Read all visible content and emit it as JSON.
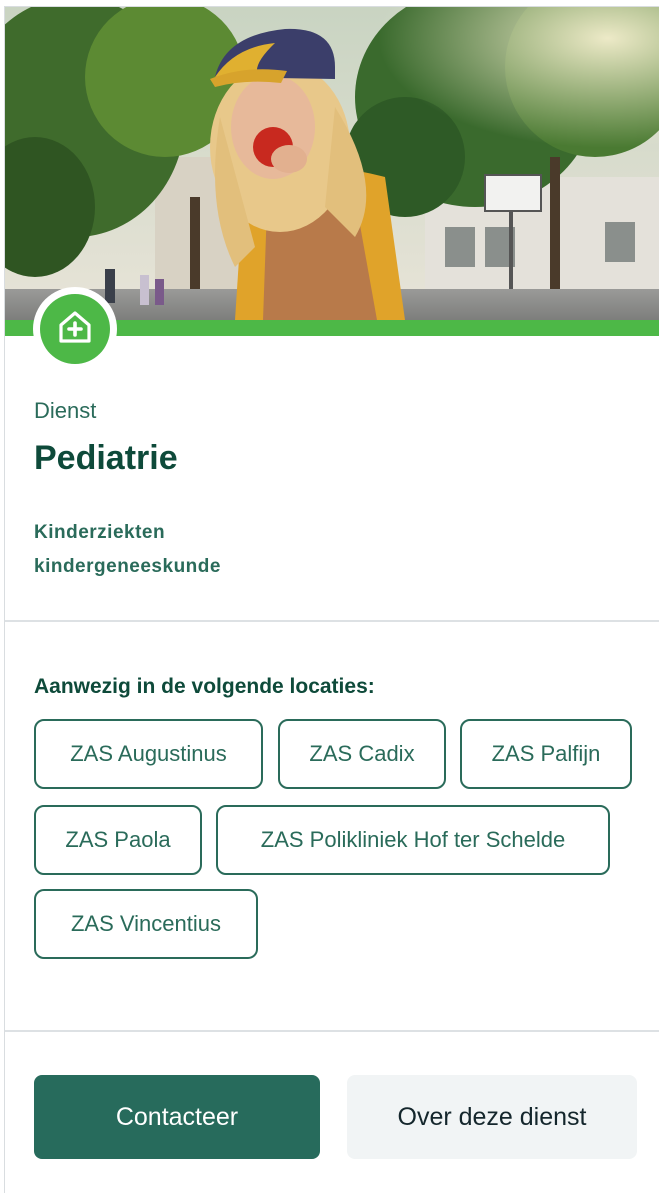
{
  "hero": {
    "image_description_icon": "child-eating-apple-photo"
  },
  "badge": {
    "icon": "house-plus-icon",
    "color": "#4db847"
  },
  "service": {
    "type_label": "Dienst",
    "title": "Pediatrie",
    "keywords": [
      "Kinderziekten",
      "kindergeneeskunde"
    ]
  },
  "locations": {
    "heading": "Aanwezig in de volgende locaties:",
    "items": [
      "ZAS Augustinus",
      "ZAS Cadix",
      "ZAS Palfijn",
      "ZAS Paola",
      "ZAS Polikliniek Hof ter Schelde",
      "ZAS Vincentius"
    ]
  },
  "actions": {
    "contact_label": "Contacteer",
    "about_label": "Over deze dienst"
  },
  "colors": {
    "accent_green": "#4db847",
    "primary_teal": "#276b5c",
    "text_dark": "#0e4a3a"
  }
}
